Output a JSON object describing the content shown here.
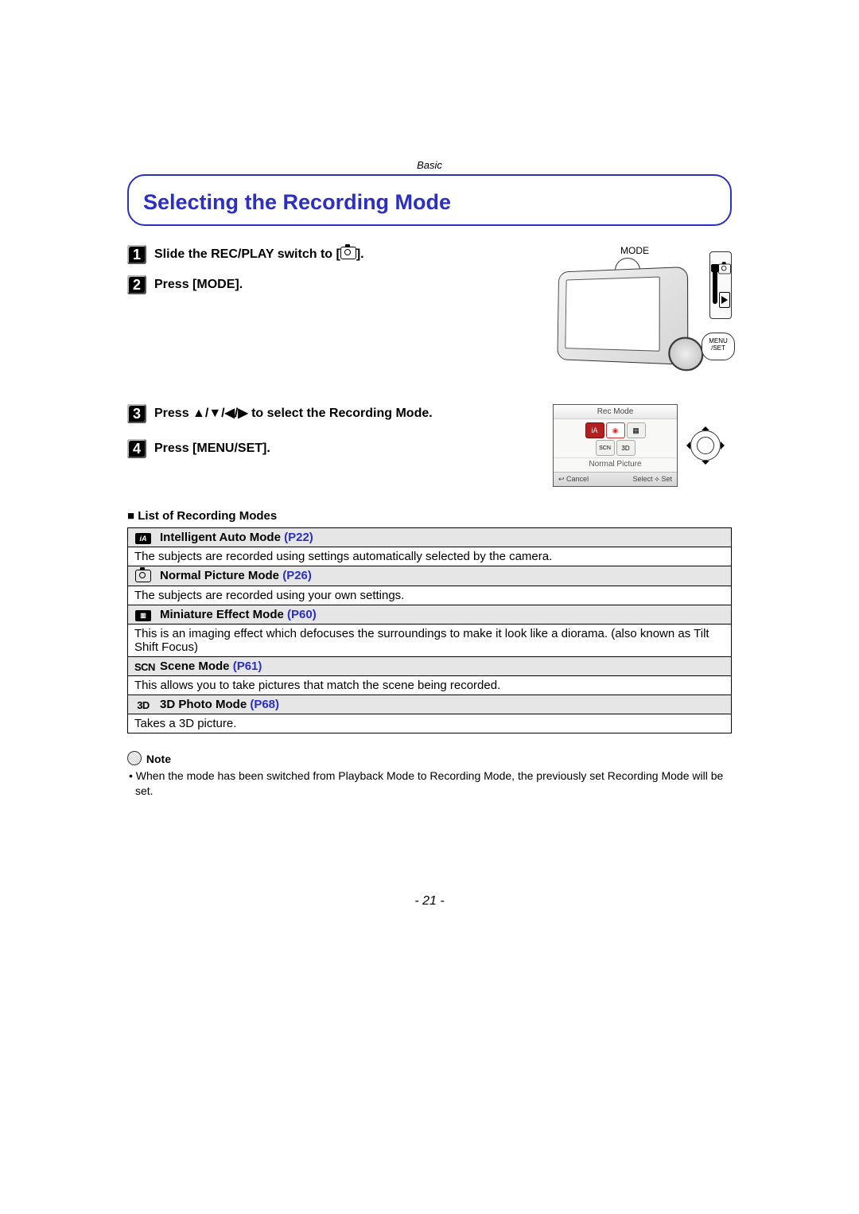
{
  "header": {
    "section": "Basic"
  },
  "title": "Selecting the Recording Mode",
  "steps": {
    "s1_pre": "Slide the REC/PLAY switch to [",
    "s1_post": "].",
    "s2": "Press [MODE].",
    "s3": "Press ▲/▼/◀/▶ to select the Recording Mode.",
    "s4": "Press [MENU/SET]."
  },
  "illus": {
    "mode_label": "MODE",
    "menu_set": "MENU\n/SET",
    "screen_title": "Rec Mode",
    "screen_sub": "Normal Picture",
    "cancel": "Cancel",
    "select": "Select",
    "set": "Set"
  },
  "list_heading": "List of Recording Modes",
  "modes": [
    {
      "icon_type": "ia",
      "name": "Intelligent Auto Mode",
      "page": "(P22)",
      "desc": "The subjects are recorded using settings automatically selected by the camera."
    },
    {
      "icon_type": "camera",
      "name": "Normal Picture Mode",
      "page": "(P26)",
      "desc": "The subjects are recorded using your own settings."
    },
    {
      "icon_type": "mini",
      "name": "Miniature Effect Mode",
      "page": "(P60)",
      "desc": "This is an imaging effect which defocuses the surroundings to make it look like a diorama. (also known as Tilt Shift Focus)"
    },
    {
      "icon_type": "scn",
      "icon_text": "SCN",
      "name": "Scene Mode",
      "page": "(P61)",
      "desc": "This allows you to take pictures that match the scene being recorded."
    },
    {
      "icon_type": "3d",
      "icon_text": "3D",
      "name": "3D Photo Mode",
      "page": "(P68)",
      "desc": "Takes a 3D picture."
    }
  ],
  "note": {
    "label": "Note",
    "bullet": "When the mode has been switched from Playback Mode to Recording Mode, the previously set Recording Mode will be set."
  },
  "page_number": "- 21 -"
}
